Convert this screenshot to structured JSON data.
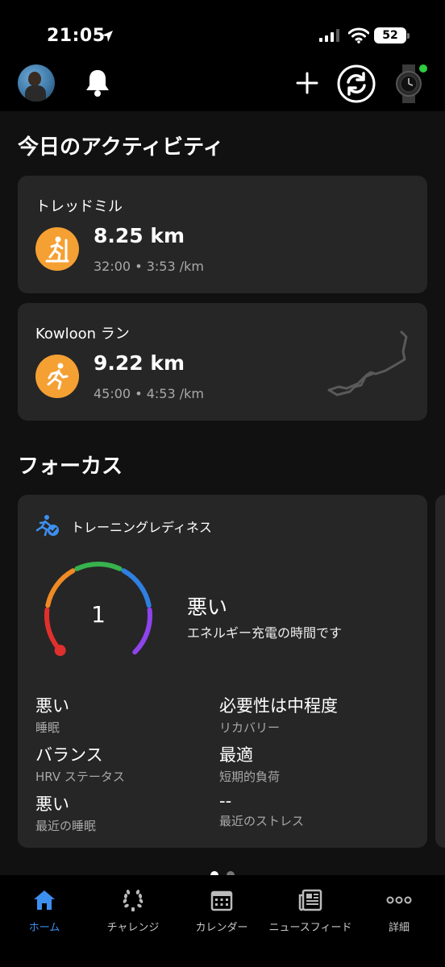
{
  "status_bar": {
    "time": "21:05",
    "battery": "52"
  },
  "today": {
    "title": "今日のアクティビティ",
    "activities": [
      {
        "name": "トレッドミル",
        "distance": "8.25 km",
        "meta": "32:00 • 3:53 /km",
        "icon": "treadmill-icon"
      },
      {
        "name": "Kowloon ラン",
        "distance": "9.22 km",
        "meta": "45:00 • 4:53 /km",
        "icon": "run-icon"
      }
    ]
  },
  "focus": {
    "title": "フォーカス",
    "card_title": "トレーニングレディネス",
    "score": "1",
    "score_fraction": 0.01,
    "state": "悪い",
    "state_sub": "エネルギー充電の時間です",
    "metrics": [
      {
        "value": "悪い",
        "label": "睡眠"
      },
      {
        "value": "必要性は中程度",
        "label": "リカバリー"
      },
      {
        "value": "バランス",
        "label": "HRV ステータス"
      },
      {
        "value": "最適",
        "label": "短期的負荷"
      },
      {
        "value": "悪い",
        "label": "最近の睡眠"
      },
      {
        "value": "--",
        "label": "最近のストレス"
      }
    ]
  },
  "pager": {
    "pages": 2,
    "active": 0
  },
  "tabs": [
    {
      "label": "ホーム",
      "icon": "home-icon",
      "active": true
    },
    {
      "label": "チャレンジ",
      "icon": "laurel-icon",
      "active": false
    },
    {
      "label": "カレンダー",
      "icon": "calendar-icon",
      "active": false
    },
    {
      "label": "ニュースフィード",
      "icon": "news-icon",
      "active": false
    },
    {
      "label": "詳細",
      "icon": "more-icon",
      "active": false
    }
  ],
  "colors": {
    "accent": "#3d8ff0",
    "activity_icon": "#f5a033",
    "card": "#262626",
    "gauge": [
      "#e0302e",
      "#f08a24",
      "#37b24d",
      "#2f7fe0",
      "#8e44ec"
    ]
  }
}
